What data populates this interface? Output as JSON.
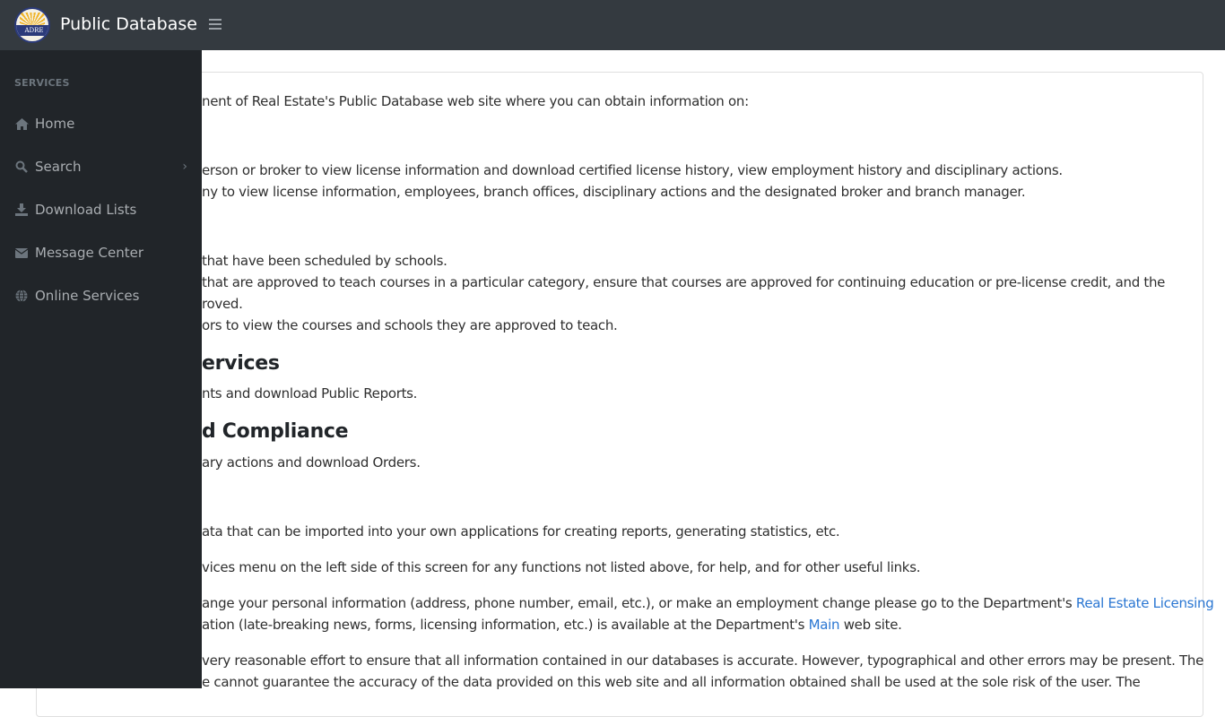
{
  "header": {
    "logo_text": "ADRE",
    "title": "Public Database",
    "menu_toggle_icon": "hamburger-icon"
  },
  "sidebar": {
    "section_label": "SERVICES",
    "items": [
      {
        "label": "Home",
        "icon": "home-icon"
      },
      {
        "label": "Search",
        "icon": "search-icon",
        "has_submenu": true
      },
      {
        "label": "Download Lists",
        "icon": "download-icon"
      },
      {
        "label": "Message Center",
        "icon": "envelope-icon"
      },
      {
        "label": "Online Services",
        "icon": "globe-icon"
      }
    ]
  },
  "main": {
    "intro": "nent of Real Estate's Public Database web site where you can obtain information on:",
    "licensing_items": [
      "erson or broker to view license information and download certified license history, view employment history and disciplinary actions.",
      "ny to view license information, employees, branch offices, disciplinary actions and the designated broker and branch manager."
    ],
    "education_items": [
      "that have been scheduled by schools.",
      "that are approved to teach courses in a particular category, ensure that courses are approved for continuing education or pre-license credit, and the",
      "roved.",
      "ors to view the courses and schools they are approved to teach."
    ],
    "services_heading": "ervices",
    "services_text": "nts and download Public Reports.",
    "compliance_heading": "d Compliance",
    "compliance_text": "ary actions and download Orders.",
    "lists_text": "ata that can be imported into your own applications for creating reports, generating statistics, etc.",
    "menu_text": "vices menu on the left side of this screen for any functions not listed above, for help, and for other useful links.",
    "change_text_1": "ange your personal information (address, phone number, email, etc.), or make an employment change please go to the Department's ",
    "change_link": "Real Estate Licensing",
    "change_text_2": "ation (late-breaking news, forms, licensing information, etc.) is available at the Department's ",
    "main_link": "Main",
    "change_text_3": " web site.",
    "disclaimer_1": "very reasonable effort to ensure that all information contained in our databases is accurate. However, typographical and other errors may be present. The",
    "disclaimer_2": "e cannot guarantee the accuracy of the data provided on this web site and all information obtained shall be used at the sole risk of the user. The"
  }
}
